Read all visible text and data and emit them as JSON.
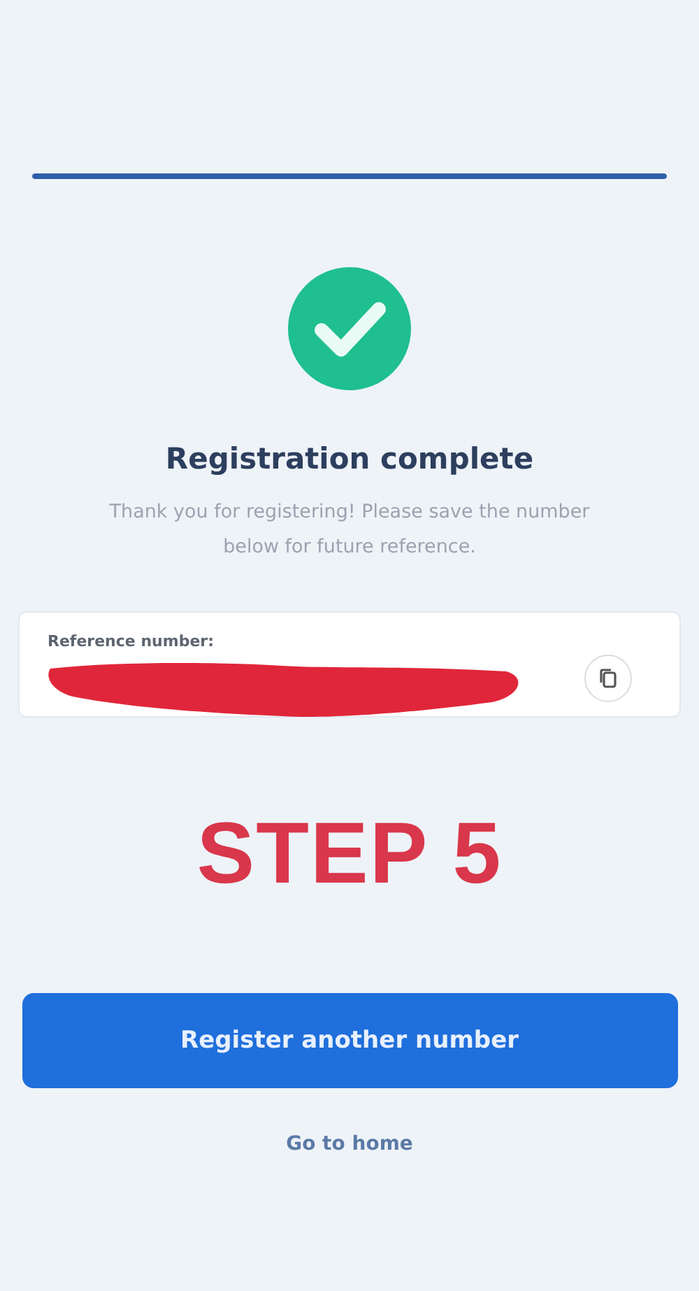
{
  "progress": {
    "level": 1
  },
  "title": "Registration complete",
  "message": "Thank you for registering! Please save the number below for future reference.",
  "reference": {
    "label": "Reference number:"
  },
  "overlay_text": "STEP 5",
  "primary_button": "Register another number",
  "link": "Go to home"
}
